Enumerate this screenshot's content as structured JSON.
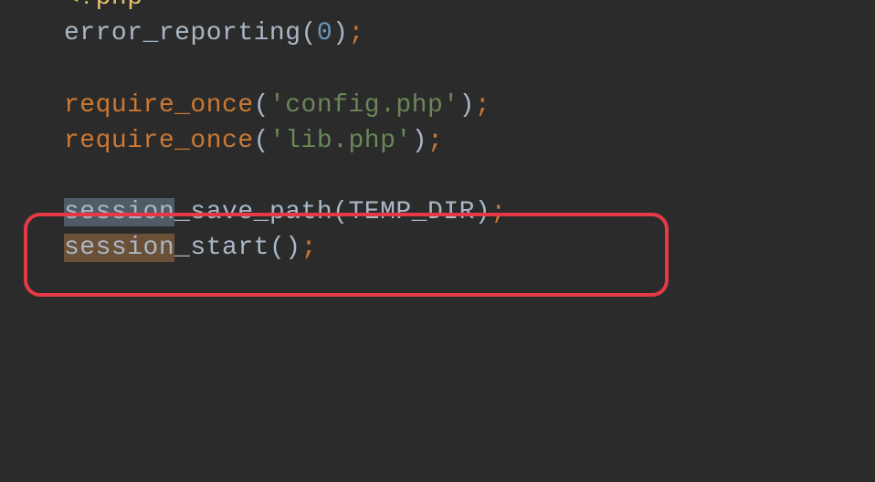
{
  "code": {
    "line1_open": "<?php",
    "line2_fn": "error_reporting",
    "line2_arg": "0",
    "line4_kw": "require_once",
    "line4_arg": "'config.php'",
    "line5_kw": "require_once",
    "line5_arg": "'lib.php'",
    "line7_fn_a": "session",
    "line7_fn_b": "_save_path",
    "line7_arg": "TEMP_DIR",
    "line8_fn_a": "session",
    "line8_fn_b": "_start"
  }
}
